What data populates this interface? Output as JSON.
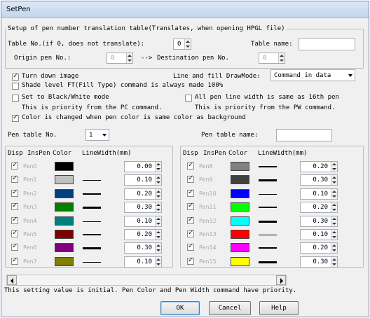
{
  "window": {
    "title": "SetPen"
  },
  "table_group": {
    "legend": "Setup of pen number translation table(Translates, when opening HPGL file)",
    "table_no_label": "Table No.(if 0, does not translate):",
    "table_no_value": "0",
    "table_name_label": "Table name:",
    "table_name_value": "",
    "origin_label": "Origin pen No.:",
    "origin_value": "0",
    "arrow": "-->",
    "dest_label": "Destination pen No.",
    "dest_value": "0"
  },
  "options": {
    "turn_down": {
      "label": "Turn down image",
      "checked": true
    },
    "line_fill_label": "Line and fill DrawMode:",
    "line_fill_value": "Command in data",
    "shade": {
      "label": "Shade level FT(Fill Type) command is always made 100%",
      "checked": false
    },
    "bw": {
      "label": "Set to Black/White mode",
      "checked": false
    },
    "bw_note": "This is priority from the PC command.",
    "all_pen": {
      "label": "All pen line width is same as 16th pen",
      "checked": false
    },
    "all_pen_note": "This is priority from the PW command.",
    "color_bg": {
      "label": "Color is changed when pen color is same color as background",
      "checked": true
    }
  },
  "pen_table": {
    "no_label": "Pen table No.",
    "no_value": "1",
    "name_label": "Pen table name:",
    "name_value": ""
  },
  "columns": {
    "headers": [
      "Disp",
      "InsPen",
      "Color",
      "LineWidth(mm)"
    ]
  },
  "pens_left": [
    {
      "label": "Pen0",
      "color": "#000000",
      "width": "0.00",
      "line": 0,
      "checked": true
    },
    {
      "label": "Pen1",
      "color": "#c0c0c0",
      "width": "0.10",
      "line": 1,
      "checked": true
    },
    {
      "label": "Pen2",
      "color": "#004080",
      "width": "0.20",
      "line": 2,
      "checked": true
    },
    {
      "label": "Pen3",
      "color": "#008000",
      "width": "0.30",
      "line": 3,
      "checked": true
    },
    {
      "label": "Pen4",
      "color": "#008080",
      "width": "0.10",
      "line": 1,
      "checked": true
    },
    {
      "label": "Pen5",
      "color": "#800000",
      "width": "0.20",
      "line": 2,
      "checked": true
    },
    {
      "label": "Pen6",
      "color": "#800080",
      "width": "0.30",
      "line": 3,
      "checked": true
    },
    {
      "label": "Pen7",
      "color": "#808000",
      "width": "0.10",
      "line": 1,
      "checked": true
    }
  ],
  "pens_right": [
    {
      "label": "Pen8",
      "color": "#808080",
      "width": "0.20",
      "line": 2,
      "checked": true
    },
    {
      "label": "Pen9",
      "color": "#404040",
      "width": "0.30",
      "line": 3,
      "checked": true
    },
    {
      "label": "Pen10",
      "color": "#0000ff",
      "width": "0.10",
      "line": 1,
      "checked": true
    },
    {
      "label": "Pen11",
      "color": "#00ff00",
      "width": "0.20",
      "line": 2,
      "checked": true
    },
    {
      "label": "Pen12",
      "color": "#00ffff",
      "width": "0.30",
      "line": 3,
      "checked": true
    },
    {
      "label": "Pen13",
      "color": "#ff0000",
      "width": "0.10",
      "line": 1,
      "checked": true
    },
    {
      "label": "Pen14",
      "color": "#ff00ff",
      "width": "0.20",
      "line": 2,
      "checked": true
    },
    {
      "label": "Pen15",
      "color": "#ffff00",
      "width": "0.30",
      "line": 3,
      "checked": true
    }
  ],
  "status_text": "This setting value is initial. Pen Color and Pen Width command have priority.",
  "buttons": {
    "ok": "OK",
    "cancel": "Cancel",
    "help": "Help"
  }
}
